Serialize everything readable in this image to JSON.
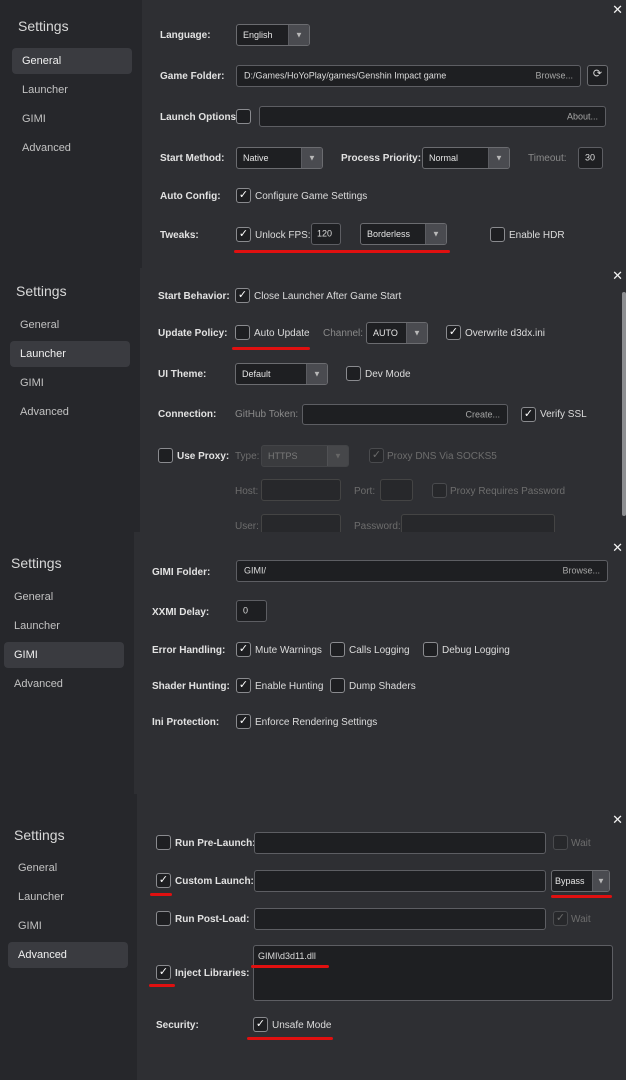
{
  "sidebar": {
    "title": "Settings",
    "items": [
      "General",
      "Launcher",
      "GIMI",
      "Advanced"
    ]
  },
  "window": {
    "close_icon": "close-icon"
  },
  "colors": {
    "sidebar_bg": "#26272b",
    "panel_bg": "#2e2f33",
    "highlight": "#e01010"
  },
  "general": {
    "language": {
      "label": "Language:",
      "value": "English"
    },
    "game_folder": {
      "label": "Game Folder:",
      "value": "D:/Games/HoYoPlay/games/Genshin Impact game",
      "browse": "Browse..."
    },
    "launch_options": {
      "label": "Launch Options:",
      "value": "",
      "about": "About..."
    },
    "start_method": {
      "label": "Start Method:",
      "value": "Native"
    },
    "process_priority": {
      "label": "Process Priority:",
      "value": "Normal"
    },
    "timeout": {
      "label": "Timeout:",
      "value": "30"
    },
    "auto_config": {
      "label": "Auto Config:",
      "checkbox": "Configure Game Settings",
      "checked": true
    },
    "tweaks": {
      "label": "Tweaks:",
      "unlock_fps": "Unlock FPS:",
      "unlock_fps_checked": true,
      "fps_value": "120",
      "window_mode": "Borderless",
      "enable_hdr": "Enable HDR",
      "enable_hdr_checked": false
    }
  },
  "launcher": {
    "start_behavior": {
      "label": "Start Behavior:",
      "checkbox": "Close Launcher After Game Start",
      "checked": true
    },
    "update_policy": {
      "label": "Update Policy:",
      "auto_update": "Auto Update",
      "auto_update_checked": false,
      "channel_label": "Channel:",
      "channel": "AUTO",
      "overwrite": "Overwrite d3dx.ini",
      "overwrite_checked": true
    },
    "ui_theme": {
      "label": "UI Theme:",
      "value": "Default",
      "dev_mode": "Dev Mode",
      "dev_mode_checked": false
    },
    "connection": {
      "label": "Connection:",
      "token_label": "GitHub Token:",
      "token_value": "",
      "create": "Create...",
      "verify_ssl": "Verify SSL",
      "verify_ssl_checked": true
    },
    "proxy": {
      "label": "Use Proxy:",
      "checked": false,
      "type_label": "Type:",
      "type": "HTTPS",
      "dns_socks": "Proxy DNS Via SOCKS5",
      "dns_socks_checked": true,
      "host_label": "Host:",
      "port_label": "Port:",
      "requires_password": "Proxy Requires Password",
      "requires_password_checked": false,
      "user_label": "User:",
      "password_label": "Password:"
    }
  },
  "gimi": {
    "folder": {
      "label": "GIMI Folder:",
      "value": "GIMI/",
      "browse": "Browse..."
    },
    "xxmi_delay": {
      "label": "XXMI Delay:",
      "value": "0"
    },
    "error_handling": {
      "label": "Error Handling:",
      "mute_warnings": "Mute Warnings",
      "mute_warnings_checked": true,
      "calls_logging": "Calls Logging",
      "calls_logging_checked": false,
      "debug_logging": "Debug Logging",
      "debug_logging_checked": false
    },
    "shader_hunting": {
      "label": "Shader Hunting:",
      "enable_hunting": "Enable Hunting",
      "enable_hunting_checked": true,
      "dump_shaders": "Dump Shaders",
      "dump_shaders_checked": false
    },
    "ini_protection": {
      "label": "Ini Protection:",
      "checkbox": "Enforce Rendering Settings",
      "checked": true
    }
  },
  "advanced": {
    "run_pre_launch": {
      "label": "Run Pre-Launch:",
      "checked": false,
      "value": "",
      "wait": "Wait",
      "wait_checked": false
    },
    "custom_launch": {
      "label": "Custom Launch:",
      "checked": true,
      "value": "",
      "mode": "Bypass"
    },
    "run_post_load": {
      "label": "Run Post-Load:",
      "checked": false,
      "value": "",
      "wait": "Wait",
      "wait_checked": true
    },
    "inject_libraries": {
      "label": "Inject Libraries:",
      "checked": true,
      "value": "GIMI\\d3d11.dll"
    },
    "security": {
      "label": "Security:",
      "checkbox": "Unsafe Mode",
      "checked": true
    }
  }
}
